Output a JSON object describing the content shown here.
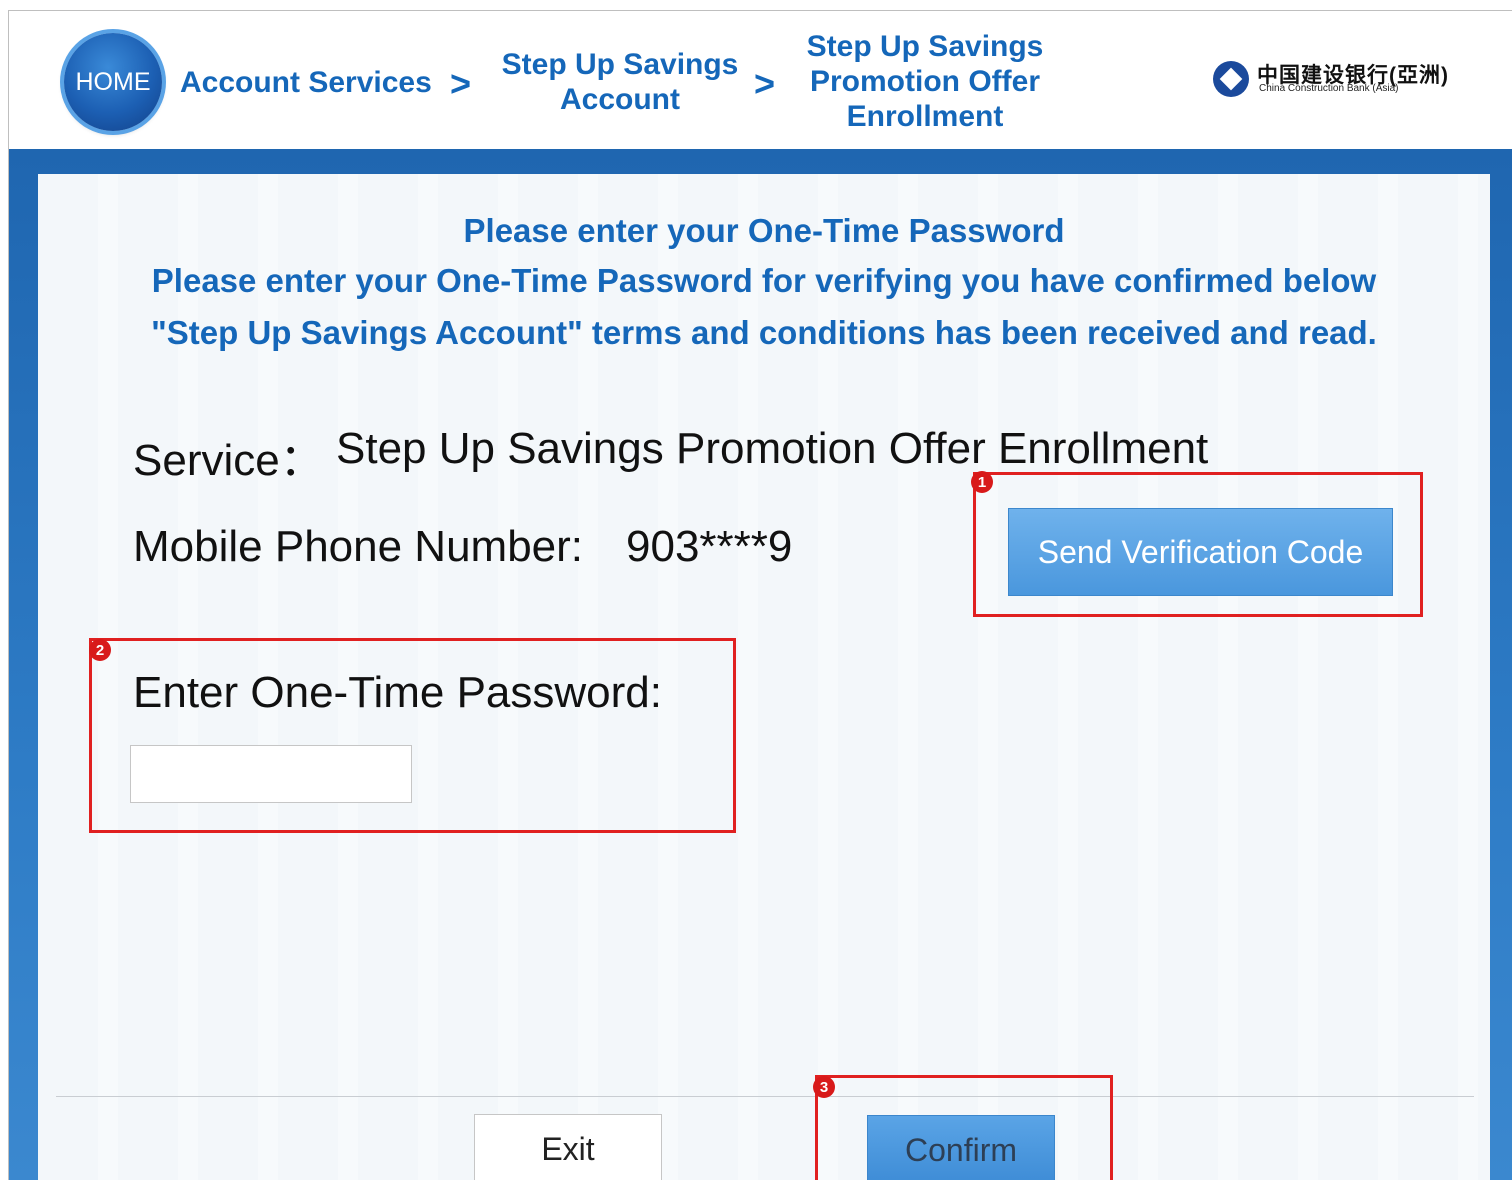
{
  "header": {
    "home_label": "HOME",
    "breadcrumbs": [
      {
        "label": "Account Services"
      },
      {
        "label": "Step Up Savings Account"
      },
      {
        "label": "Step Up Savings Promotion Offer Enrollment"
      }
    ],
    "chevron": ">",
    "logo": {
      "name_cn": "中国建设银行(亞洲)",
      "name_en": "China Construction Bank (Asia)"
    }
  },
  "main": {
    "heading": "Please enter your One-Time Password",
    "instruction_line1": "Please enter your One-Time Password for verifying you have confirmed below",
    "instruction_line2": "\"Step Up Savings Account\" terms and conditions has been received and read.",
    "service_label": "Service：",
    "service_value": "Step Up Savings Promotion Offer Enrollment",
    "mobile_label": "Mobile Phone Number:",
    "mobile_value": "903****9",
    "send_code_button": "Send Verification Code",
    "otp_label": "Enter One-Time Password:",
    "otp_value": ""
  },
  "footer": {
    "exit_button": "Exit",
    "confirm_button": "Confirm"
  },
  "annotations": {
    "marker1": "1",
    "marker2": "2",
    "marker3": "3"
  },
  "colors": {
    "accent": "#1567b9",
    "band": "#2e7cc6",
    "button": "#4a97dd",
    "highlight": "#e02020"
  }
}
